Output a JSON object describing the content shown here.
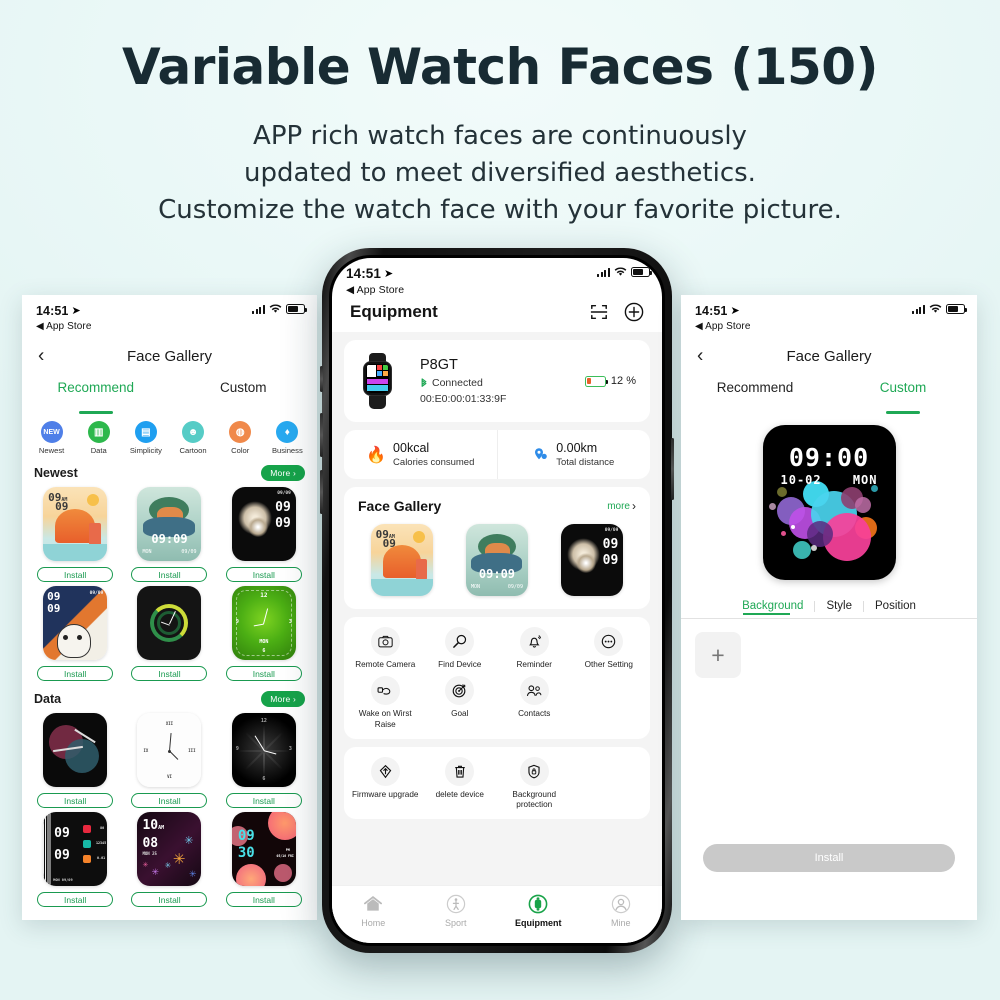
{
  "header": {
    "title": "Variable Watch Faces (150)",
    "subtitle_lines": [
      "APP rich watch faces are continuously",
      "updated to meet diversified aesthetics.",
      "Customize the watch face with your favorite picture."
    ]
  },
  "status_bar": {
    "time": "14:51",
    "location_icon": "location-arrow-icon",
    "back_app": "App Store",
    "signal_icon": "cellular-signal-icon",
    "wifi_icon": "wifi-icon",
    "battery_icon": "battery-icon"
  },
  "left_screen": {
    "nav": {
      "back_icon": "chevron-left-icon",
      "title": "Face Gallery"
    },
    "tabs": [
      {
        "label": "Recommend",
        "active": true
      },
      {
        "label": "Custom",
        "active": false
      }
    ],
    "categories": [
      {
        "label": "Newest",
        "icon": "new-badge-icon",
        "color": "#4f7fe8",
        "glyph": "NEW"
      },
      {
        "label": "Data",
        "icon": "bar-chart-icon",
        "color": "#2db84c",
        "glyph": "▮▮"
      },
      {
        "label": "Simplicity",
        "icon": "square-pen-icon",
        "color": "#1f9ff0",
        "glyph": "▤"
      },
      {
        "label": "Cartoon",
        "icon": "robot-face-icon",
        "color": "#56ccc6",
        "glyph": "☻"
      },
      {
        "label": "Color",
        "icon": "palette-icon",
        "color": "#f0894a",
        "glyph": "◍"
      },
      {
        "label": "Business",
        "icon": "tie-icon",
        "color": "#28a9f0",
        "glyph": "▾"
      }
    ],
    "sections": [
      {
        "title": "Newest",
        "more_label": "More ›",
        "faces": [
          {
            "name": "sunset-mountain-face",
            "install_label": "Install",
            "time": "09",
            "ampm": "AM",
            "time2": "09"
          },
          {
            "name": "deer-landscape-face",
            "install_label": "Install",
            "time": "09:09",
            "sub_left": "MON",
            "sub_right": "09/09"
          },
          {
            "name": "white-flowers-face",
            "install_label": "Install",
            "time": "09",
            "time2": "09",
            "date": "09/09"
          },
          {
            "name": "dog-navy-orange-face",
            "install_label": "Install",
            "time": "09",
            "time2": "09",
            "date": "09/09"
          },
          {
            "name": "green-dial-rings-face",
            "install_label": "Install"
          },
          {
            "name": "green-analog-face",
            "install_label": "Install",
            "sub_left": "MON"
          }
        ]
      },
      {
        "title": "Data",
        "more_label": "More ›",
        "faces": [
          {
            "name": "circles-analog-face",
            "install_label": "Install"
          },
          {
            "name": "white-roman-analog-face",
            "install_label": "Install"
          },
          {
            "name": "black-starburst-analog-face",
            "install_label": "Install"
          },
          {
            "name": "data-metrics-face",
            "install_label": "Install",
            "time": "09",
            "time2": "09",
            "date": "MON 09/09",
            "m1": "80",
            "m2": "12345",
            "m3": "0.01"
          },
          {
            "name": "flowers-purple-face",
            "install_label": "Install",
            "time": "10",
            "ampm": "AM",
            "time2": "08",
            "date": "MON 25"
          },
          {
            "name": "neon-bubbles-face",
            "install_label": "Install",
            "time": "09",
            "time2": "30",
            "ampm": "PM",
            "date": "05/10 FRI"
          }
        ]
      }
    ]
  },
  "center_screen": {
    "page_title": "Equipment",
    "scan_icon": "scan-frame-icon",
    "add_icon": "plus-circle-icon",
    "device": {
      "name": "P8GT",
      "bluetooth_icon": "bluetooth-icon",
      "status": "Connected",
      "mac": "00:E0:00:01:33:9F",
      "battery": "12 %",
      "battery_icon": "battery-low-icon",
      "image_name": "smartwatch-product-image"
    },
    "stats": [
      {
        "value": "00kcal",
        "label": "Calories consumed",
        "icon": "flame-icon"
      },
      {
        "value": "0.00km",
        "label": "Total distance",
        "icon": "location-pin-icon"
      }
    ],
    "face_gallery": {
      "title": "Face Gallery",
      "more_label": "more",
      "more_icon": "chevron-right-icon",
      "faces": [
        {
          "name": "sunset-mountain-face",
          "time": "09",
          "ampm": "AM",
          "time2": "09"
        },
        {
          "name": "deer-landscape-face",
          "time": "09:09",
          "sub_left": "MON",
          "sub_right": "09/09"
        },
        {
          "name": "white-flowers-face",
          "time": "09",
          "time2": "09",
          "date": "09/09"
        }
      ]
    },
    "functions": [
      {
        "label": "Remote Camera",
        "icon": "camera-icon"
      },
      {
        "label": "Find Device",
        "icon": "magnifier-icon"
      },
      {
        "label": "Reminder",
        "icon": "bell-icon"
      },
      {
        "label": "Other Setting",
        "icon": "ellipsis-circle-icon"
      },
      {
        "label": "Wake on Wirst Raise",
        "icon": "wrist-raise-icon"
      },
      {
        "label": "Goal",
        "icon": "target-icon"
      },
      {
        "label": "Contacts",
        "icon": "contacts-icon"
      }
    ],
    "maintenance": [
      {
        "label": "Firmware upgrade",
        "icon": "firmware-upgrade-icon"
      },
      {
        "label": "delete device",
        "icon": "trash-icon"
      },
      {
        "label": "Background protection",
        "icon": "shield-lock-icon"
      }
    ],
    "tabbar": [
      {
        "label": "Home",
        "icon": "home-icon",
        "active": false
      },
      {
        "label": "Sport",
        "icon": "running-icon",
        "active": false
      },
      {
        "label": "Equipment",
        "icon": "watch-icon",
        "active": true
      },
      {
        "label": "Mine",
        "icon": "person-icon",
        "active": false
      }
    ]
  },
  "right_screen": {
    "nav": {
      "back_icon": "chevron-left-icon",
      "title": "Face Gallery"
    },
    "tabs": [
      {
        "label": "Recommend",
        "active": false
      },
      {
        "label": "Custom",
        "active": true
      }
    ],
    "preview_face": {
      "name": "custom-bubbles-face",
      "time": "09:00",
      "date": "10-02",
      "weekday": "MON"
    },
    "sub_tabs": [
      {
        "label": "Background",
        "active": true
      },
      {
        "label": "Style",
        "active": false
      },
      {
        "label": "Position",
        "active": false
      }
    ],
    "add_tile_icon": "plus-icon",
    "install_label": "Install"
  },
  "colors": {
    "page_bg": "#e9f7f6",
    "accent_green": "#1fa855",
    "pill_green": "#16a34a",
    "title_text": "#182b33"
  }
}
